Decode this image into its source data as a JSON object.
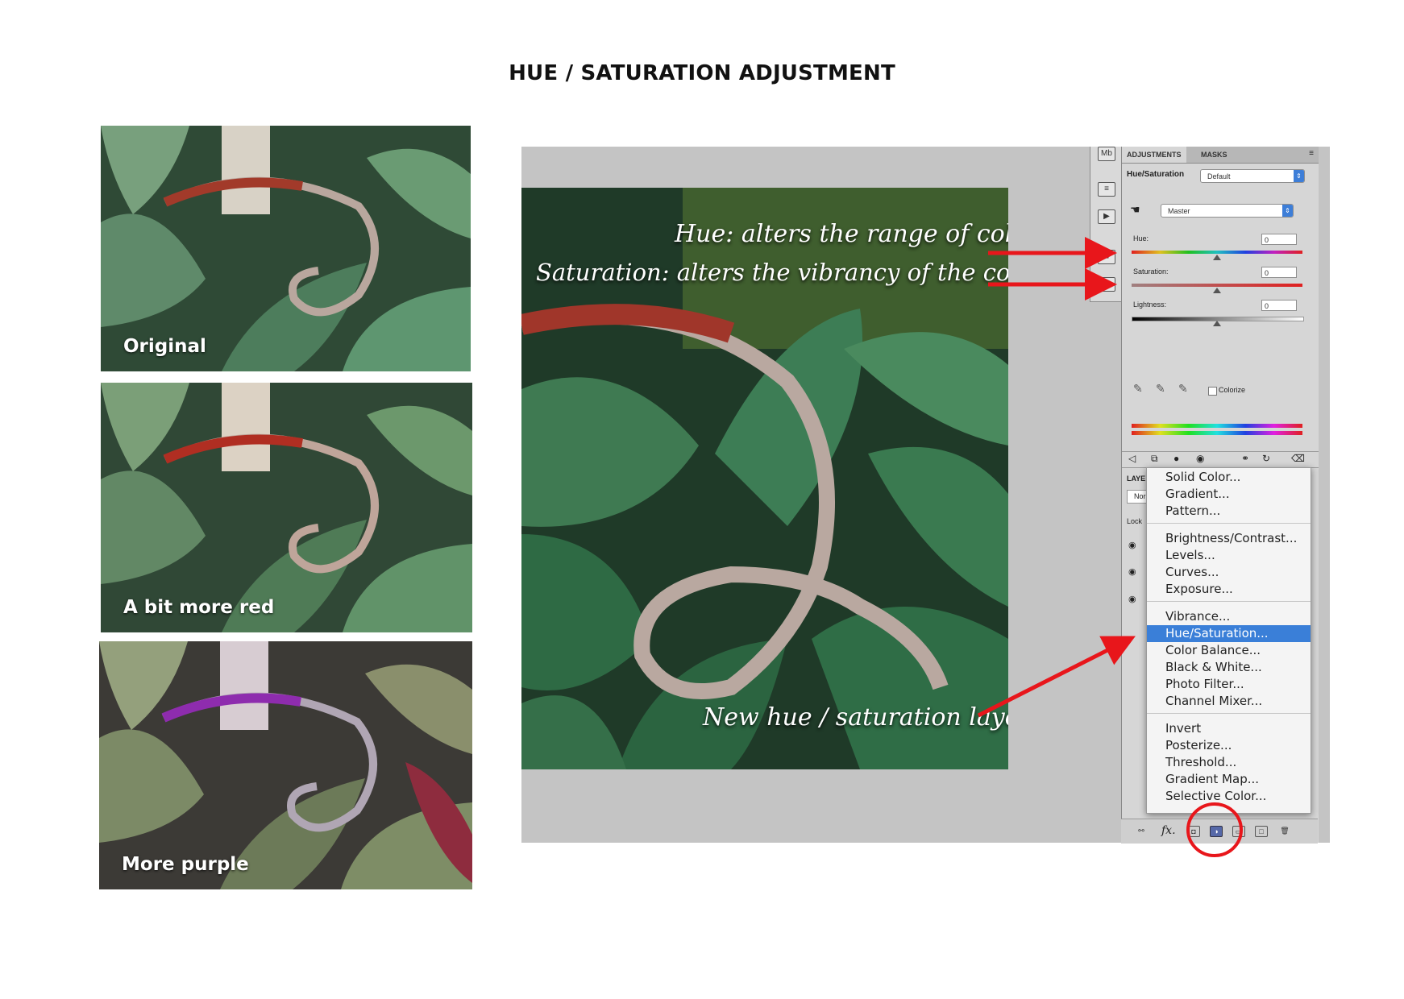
{
  "page": {
    "title": "HUE / SATURATION ADJUSTMENT"
  },
  "thumbnails": [
    {
      "label": "Original"
    },
    {
      "label": "A bit more red"
    },
    {
      "label": "More purple"
    }
  ],
  "annotations": {
    "hue": "Hue: alters the range of colours",
    "saturation": "Saturation: alters the vibrancy of the colours",
    "layer": "New hue / saturation layer"
  },
  "panel": {
    "tabs": [
      "ADJUSTMENTS",
      "MASKS"
    ],
    "title": "Hue/Saturation",
    "preset": "Default",
    "channel": "Master",
    "hue_label": "Hue:",
    "hue_value": "0",
    "saturation_label": "Saturation:",
    "saturation_value": "0",
    "lightness_label": "Lightness:",
    "lightness_value": "0",
    "colorize_label": "Colorize",
    "layers_tab_partial": "LAYE",
    "blend_partial": "Nor",
    "lock_partial": "Lock",
    "fx_label": "fx."
  },
  "menu": {
    "groups": [
      [
        "Solid Color...",
        "Gradient...",
        "Pattern..."
      ],
      [
        "Brightness/Contrast...",
        "Levels...",
        "Curves...",
        "Exposure..."
      ],
      [
        "Vibrance...",
        "Hue/Saturation...",
        "Color Balance...",
        "Black & White...",
        "Photo Filter...",
        "Channel Mixer..."
      ],
      [
        "Invert",
        "Posterize...",
        "Threshold...",
        "Gradient Map...",
        "Selective Color..."
      ]
    ],
    "selected": "Hue/Saturation..."
  },
  "colors": {
    "arrow": "#e8161b",
    "highlight": "#3a7fd8",
    "circle": "#e8161b"
  },
  "icons": [
    "eyedropper-icon",
    "eye-icon",
    "link-icon",
    "trash-icon",
    "adjustment-layer-icon"
  ]
}
